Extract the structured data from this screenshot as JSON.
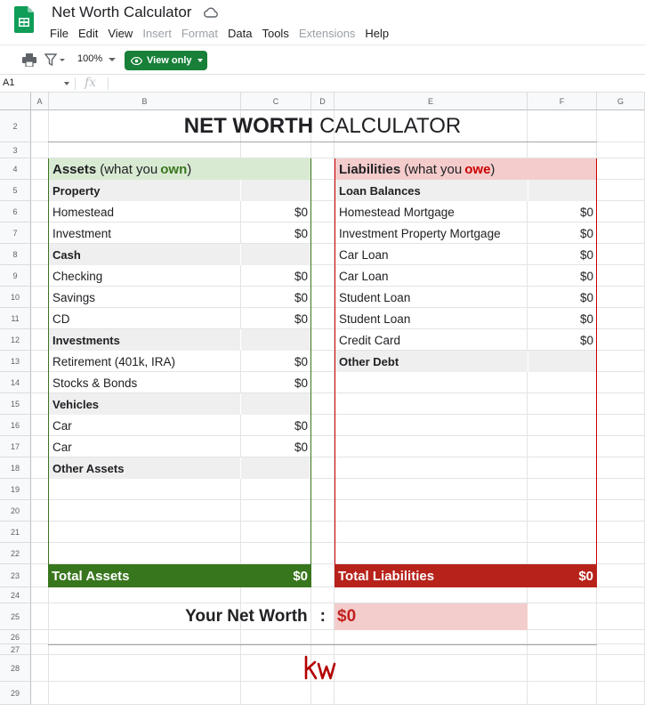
{
  "app": {
    "title": "Net Worth Calculator",
    "menu": [
      {
        "label": "File",
        "enabled": true
      },
      {
        "label": "Edit",
        "enabled": true
      },
      {
        "label": "View",
        "enabled": true
      },
      {
        "label": "Insert",
        "enabled": false
      },
      {
        "label": "Format",
        "enabled": false
      },
      {
        "label": "Data",
        "enabled": true
      },
      {
        "label": "Tools",
        "enabled": true
      },
      {
        "label": "Extensions",
        "enabled": false
      },
      {
        "label": "Help",
        "enabled": true
      }
    ]
  },
  "toolbar": {
    "zoom": "100%",
    "view_only_label": "View only"
  },
  "formula_bar": {
    "cell_ref": "A1",
    "fx": "fx",
    "value": ""
  },
  "columns": [
    "A",
    "B",
    "C",
    "D",
    "E",
    "F",
    "G"
  ],
  "rows": [
    "2",
    "3",
    "4",
    "5",
    "6",
    "7",
    "8",
    "9",
    "10",
    "11",
    "12",
    "13",
    "14",
    "15",
    "16",
    "17",
    "18",
    "19",
    "20",
    "21",
    "22",
    "23",
    "24",
    "25",
    "26",
    "27",
    "28",
    "29"
  ],
  "sheet": {
    "title_bold": "NET WORTH",
    "title_regular": "CALCULATOR",
    "assets": {
      "header_bold": "Assets",
      "header_prefix": "(what you",
      "header_accent": "own",
      "header_suffix": ")",
      "items": [
        {
          "label": "Property",
          "value": "",
          "category": true
        },
        {
          "label": "Homestead",
          "value": "$0",
          "category": false
        },
        {
          "label": "Investment",
          "value": "$0",
          "category": false
        },
        {
          "label": "Cash",
          "value": "",
          "category": true
        },
        {
          "label": "Checking",
          "value": "$0",
          "category": false
        },
        {
          "label": "Savings",
          "value": "$0",
          "category": false
        },
        {
          "label": "CD",
          "value": "$0",
          "category": false
        },
        {
          "label": "Investments",
          "value": "",
          "category": true
        },
        {
          "label": "Retirement (401k, IRA)",
          "value": "$0",
          "category": false
        },
        {
          "label": "Stocks & Bonds",
          "value": "$0",
          "category": false
        },
        {
          "label": "Vehicles",
          "value": "",
          "category": true
        },
        {
          "label": "Car",
          "value": "$0",
          "category": false
        },
        {
          "label": "Car",
          "value": "$0",
          "category": false
        },
        {
          "label": "Other Assets",
          "value": "",
          "category": true
        }
      ],
      "total_label": "Total Assets",
      "total_value": "$0"
    },
    "liabilities": {
      "header_bold": "Liabilities",
      "header_prefix": "(what you",
      "header_accent": "owe",
      "header_suffix": ")",
      "items": [
        {
          "label": "Loan Balances",
          "value": "",
          "category": true
        },
        {
          "label": "Homestead Mortgage",
          "value": "$0",
          "category": false
        },
        {
          "label": "Investment Property Mortgage",
          "value": "$0",
          "category": false
        },
        {
          "label": "Car Loan",
          "value": "$0",
          "category": false
        },
        {
          "label": "Car Loan",
          "value": "$0",
          "category": false
        },
        {
          "label": "Student Loan",
          "value": "$0",
          "category": false
        },
        {
          "label": "Student Loan",
          "value": "$0",
          "category": false
        },
        {
          "label": "Credit Card",
          "value": "$0",
          "category": false
        },
        {
          "label": "Other Debt",
          "value": "",
          "category": true
        }
      ],
      "total_label": "Total Liabilities",
      "total_value": "$0"
    },
    "net_worth_label": "Your Net Worth",
    "net_worth_colon": ":",
    "net_worth_value": "$0"
  },
  "colors": {
    "assets_border": "#38761d",
    "assets_header_bg": "#d9ead3",
    "assets_accent": "#38761d",
    "assets_total_bg": "#38761d",
    "liabilities_border": "#cc0000",
    "liabilities_header_bg": "#f4cccc",
    "liabilities_accent": "#cc0000",
    "liabilities_total_bg": "#b7221b",
    "kw_logo": "#b40101"
  }
}
